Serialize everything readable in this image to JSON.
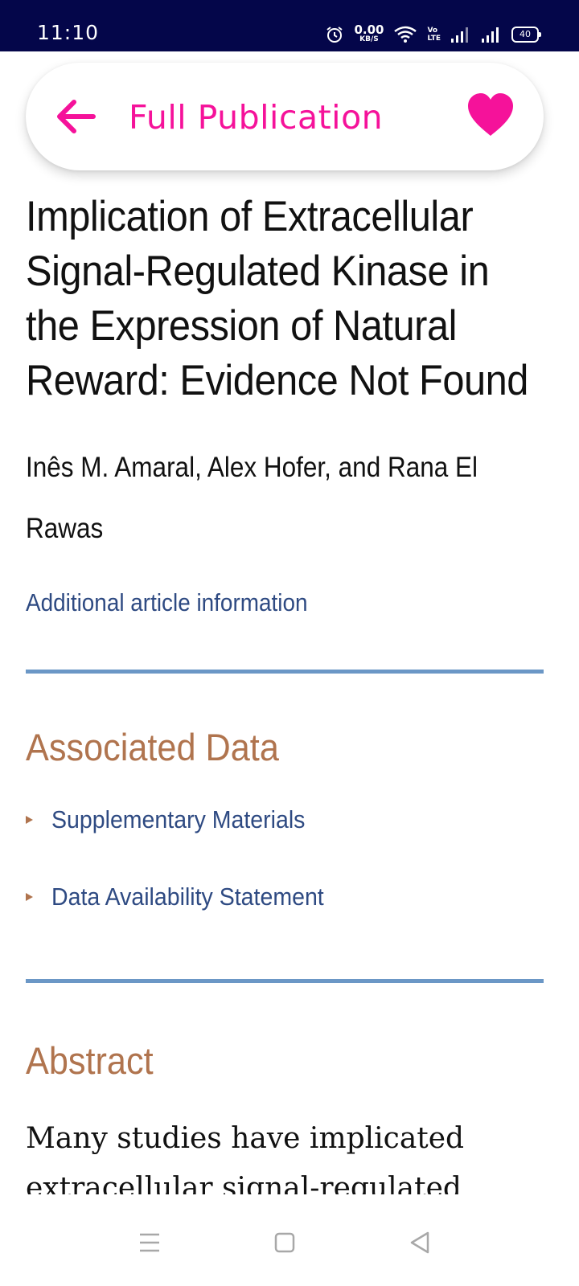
{
  "status_bar": {
    "time": "11:10",
    "net_speed_value": "0.00",
    "net_speed_unit": "KB/S",
    "volte_top": "Vo",
    "volte_bottom": "LTE",
    "battery": "40",
    "icons": [
      "alarm-icon",
      "wifi-icon",
      "signal-icon",
      "signal-icon",
      "battery-icon"
    ]
  },
  "app_bar": {
    "title": "Full Publication",
    "back_icon": "arrow-left-icon",
    "favorite_icon": "heart-icon",
    "accent_color": "#f5129a"
  },
  "article": {
    "title": "Implication of Extracellular Signal-Regulated Kinase in the Expression of Natural Reward: Evidence Not Found",
    "authors": "Inês M. Amaral, Alex Hofer, and Rana El Rawas",
    "info_link": "Additional article information"
  },
  "associated_data": {
    "heading": "Associated Data",
    "items": [
      {
        "label": "Supplementary Materials"
      },
      {
        "label": "Data Availability Statement"
      }
    ]
  },
  "abstract": {
    "heading": "Abstract",
    "text": "Many studies have implicated extracellular signal-regulated kinase"
  },
  "colors": {
    "section_heading": "#b0744e",
    "link": "#2e4a82",
    "divider": "#6b97c6",
    "status_bar": "#04064a"
  },
  "nav_bar": {
    "icons": [
      "menu-icon",
      "home-square-icon",
      "back-triangle-icon"
    ]
  }
}
